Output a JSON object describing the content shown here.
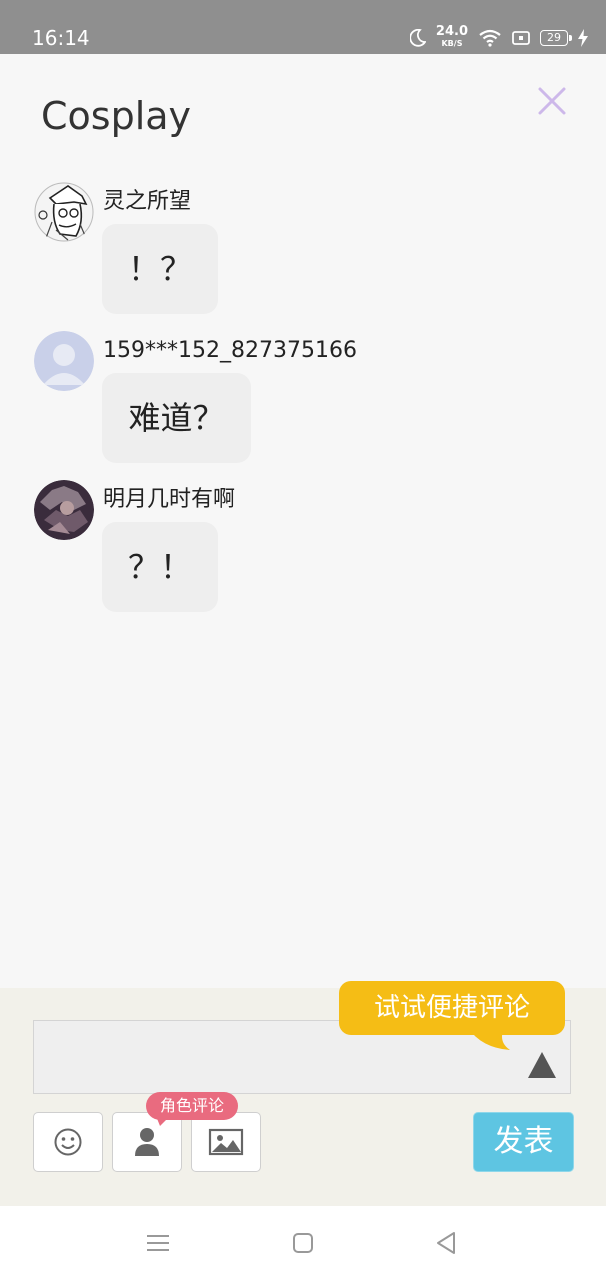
{
  "status_bar": {
    "time": "16:14",
    "net_speed_value": "24.0",
    "net_speed_unit": "KB/S",
    "battery_level": "29",
    "icons": [
      "moon-icon",
      "net-speed",
      "wifi-icon",
      "notification-icon",
      "battery-icon",
      "charging-icon"
    ]
  },
  "header": {
    "title": "Cosplay",
    "close_icon": "close-icon"
  },
  "comments": [
    {
      "username": "灵之所望",
      "content": "！？"
    },
    {
      "username": "159***152_827375166",
      "content": "难道？"
    },
    {
      "username": "明月几时有啊",
      "content": "？！"
    }
  ],
  "composer": {
    "input_value": "",
    "tooltip_text": "试试便捷评论",
    "role_badge": "角色评论",
    "post_label": "发表",
    "tools": [
      "emoji-icon",
      "person-icon",
      "image-icon"
    ]
  },
  "colors": {
    "tooltip": "#f5bd15",
    "post_button": "#5ec5e2",
    "role_badge": "#e96b7f",
    "close_icon": "#cdb8ea",
    "status_bar": "#8f8f8f"
  },
  "nav": [
    "menu-icon",
    "home-icon",
    "back-icon"
  ]
}
